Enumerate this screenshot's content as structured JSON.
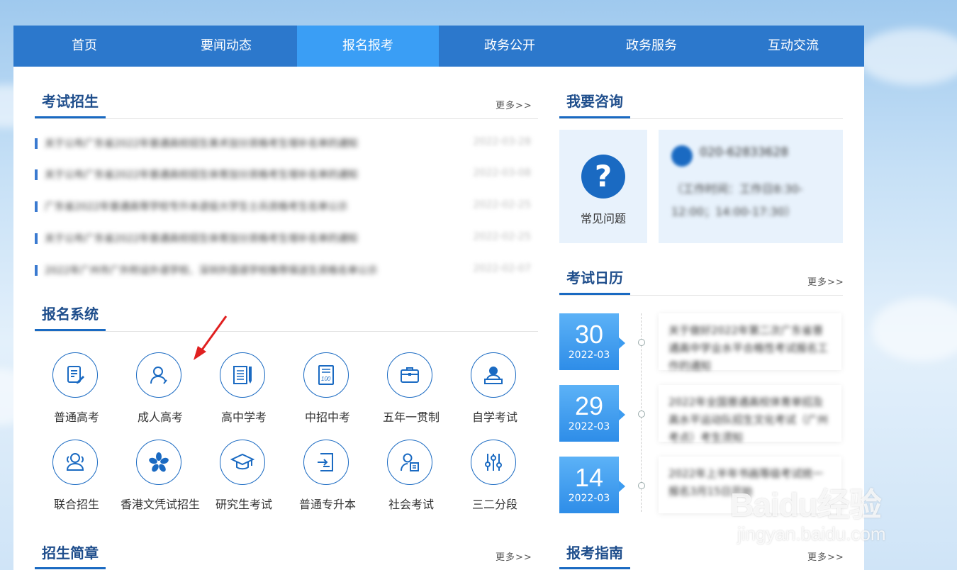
{
  "nav": {
    "items": [
      {
        "label": "首页"
      },
      {
        "label": "要闻动态"
      },
      {
        "label": "报名报考"
      },
      {
        "label": "政务公开"
      },
      {
        "label": "政务服务"
      },
      {
        "label": "互动交流"
      }
    ],
    "active_index": 2
  },
  "exam_recruit": {
    "title": "考试招生",
    "more": "更多>>",
    "news": [
      {
        "title": "关于公布广东省2022年普通高校招生美术加分资格考生增补名单的通知",
        "date": "2022-03-28"
      },
      {
        "title": "关于公布广东省2022年普通高校招生体育加分资格考生增补名单的通知",
        "date": "2022-03-08"
      },
      {
        "title": "广东省2022年普通高等学校专升本退役大学生士兵资格考生名单公示",
        "date": "2022-02-25"
      },
      {
        "title": "关于公布广东省2022年普通高校招生体育加分资格考生增补名单的通知",
        "date": "2022-02-25"
      },
      {
        "title": "2022年广州市广外附设外语学校、深圳外国语学校推荐保送生资格名单公示",
        "date": "2022-02-07"
      }
    ]
  },
  "signup_system": {
    "title": "报名系统",
    "items": [
      {
        "label": "普通高考",
        "icon": "exam-form-icon"
      },
      {
        "label": "成人高考",
        "icon": "adult-person-icon"
      },
      {
        "label": "高中学考",
        "icon": "book-pen-icon"
      },
      {
        "label": "中招中考",
        "icon": "score-paper-icon"
      },
      {
        "label": "五年一贯制",
        "icon": "briefcase-icon"
      },
      {
        "label": "自学考试",
        "icon": "self-study-icon"
      },
      {
        "label": "联合招生",
        "icon": "group-people-icon"
      },
      {
        "label": "香港文凭试招生",
        "icon": "bauhinia-icon"
      },
      {
        "label": "研究生考试",
        "icon": "graduation-cap-icon"
      },
      {
        "label": "普通专升本",
        "icon": "upgrade-doc-icon"
      },
      {
        "label": "社会考试",
        "icon": "person-doc-icon"
      },
      {
        "label": "三二分段",
        "icon": "sliders-icon"
      }
    ]
  },
  "recruit_brochure": {
    "title": "招生简章",
    "more": "更多>>"
  },
  "consult": {
    "title": "我要咨询",
    "faq_label": "常见问题",
    "faq_symbol": "?",
    "phone": "020-62833628",
    "hours": "（工作时间：工作日8:30-12:00；14:00-17:30）"
  },
  "exam_calendar": {
    "title": "考试日历",
    "more": "更多>>",
    "events": [
      {
        "day": "30",
        "ym": "2022-03",
        "text": "关于做好2022年第二次广东省普通高中学业水平合格性考试报名工作的通知"
      },
      {
        "day": "29",
        "ym": "2022-03",
        "text": "2022年全国普通高校体育单招及高水平运动队招生文化考试（广州考点）考生须知"
      },
      {
        "day": "14",
        "ym": "2022-03",
        "text": "2022年上半年书画等级考试统一报名3月15日开始"
      }
    ]
  },
  "exam_guide": {
    "title": "报考指南",
    "more": "更多>>"
  },
  "watermark": {
    "brand": "Baidu经验",
    "url": "jingyan.baidu.com"
  },
  "colors": {
    "nav": "#2c78cc",
    "nav_active": "#3a9ef5",
    "accent": "#1a6ac2",
    "arrow": "#e02020"
  }
}
